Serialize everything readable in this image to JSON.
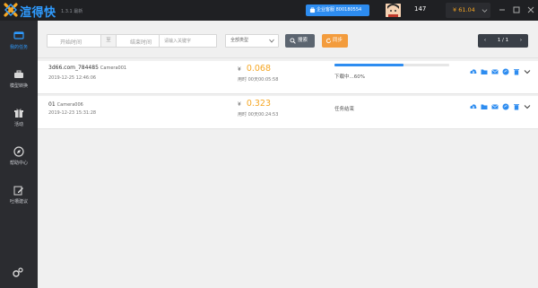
{
  "app": {
    "name": "渲得快",
    "version": "1.3.1 最新"
  },
  "header": {
    "support_label": "企业客服 800180554",
    "user_id": "147",
    "balance": "¥ 61.04"
  },
  "sidebar": {
    "items": [
      {
        "label": "我的任务",
        "icon": "monitor-icon",
        "active": true
      },
      {
        "label": "模型转换",
        "icon": "briefcase-icon",
        "active": false
      },
      {
        "label": "活动",
        "icon": "gift-icon",
        "active": false
      },
      {
        "label": "帮助中心",
        "icon": "compass-icon",
        "active": false
      },
      {
        "label": "吐槽建议",
        "icon": "edit-icon",
        "active": false
      }
    ]
  },
  "toolbar": {
    "start_date_placeholder": "开始时间",
    "date_separator": "至",
    "end_date_placeholder": "结束时间",
    "keyword_placeholder": "请输入关键字",
    "type_select_value": "全部类型",
    "search_label": "搜索",
    "sync_label": "同步",
    "pager_prev": "‹",
    "pager_text": "1 / 1",
    "pager_next": "›"
  },
  "tasks": [
    {
      "name": "3d66.com_784485",
      "camera": "Camera001",
      "date": "2019-12-25 12:46:06",
      "yen": "¥",
      "price": "0.068",
      "duration": "用时 00天00:05:58",
      "progress": 0.6,
      "status": "下载中...60%"
    },
    {
      "name": "01",
      "camera": "Camera006",
      "date": "2019-12-23 15:31:28",
      "yen": "¥",
      "price": "0.323",
      "duration": "用时 00天00:24:53",
      "progress": null,
      "status": "任务结束"
    }
  ],
  "colors": {
    "accent": "#2d8cf0",
    "orange": "#f5a623",
    "sidebar_bg": "#2b2c30",
    "title_bg": "#1f2023"
  }
}
